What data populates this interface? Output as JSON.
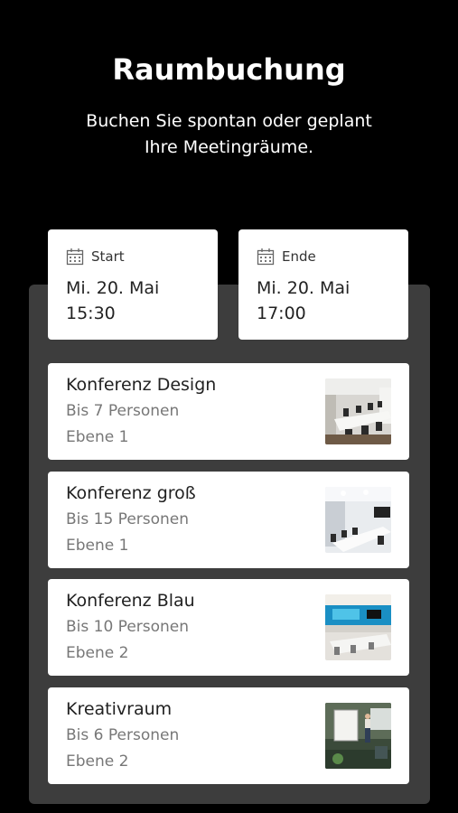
{
  "header": {
    "title": "Raumbuchung",
    "subtitle_line1": "Buchen Sie spontan oder geplant",
    "subtitle_line2": "Ihre Meetingräume."
  },
  "start": {
    "label": "Start",
    "date": "Mi. 20. Mai",
    "time": "15:30",
    "icon": "calendar-icon"
  },
  "end": {
    "label": "Ende",
    "date": "Mi. 20. Mai",
    "time": "17:00",
    "icon": "calendar-icon"
  },
  "rooms": [
    {
      "name": "Konferenz Design",
      "capacity": "Bis 7 Personen",
      "level": "Ebene 1"
    },
    {
      "name": "Konferenz groß",
      "capacity": "Bis 15 Personen",
      "level": "Ebene 1"
    },
    {
      "name": "Konferenz Blau",
      "capacity": "Bis 10 Personen",
      "level": "Ebene 2"
    },
    {
      "name": "Kreativraum",
      "capacity": "Bis 6 Personen",
      "level": "Ebene 2"
    }
  ],
  "colors": {
    "background": "#000000",
    "panel": "#3d3d3d",
    "card": "#ffffff",
    "secondary_text": "#777777"
  }
}
